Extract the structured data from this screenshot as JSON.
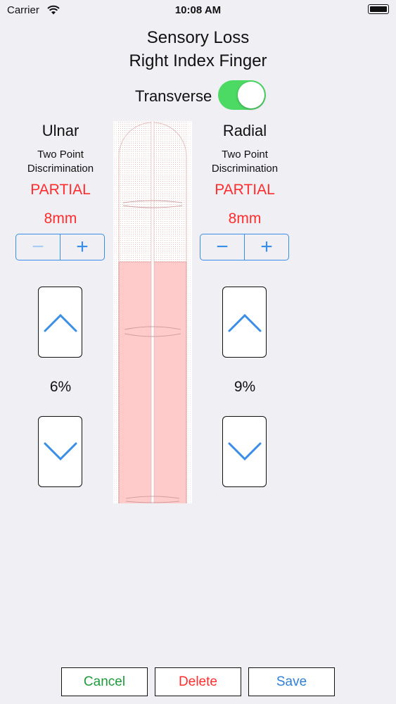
{
  "status_bar": {
    "carrier": "Carrier",
    "time": "10:08 AM"
  },
  "header": {
    "title_line1": "Sensory Loss",
    "title_line2": "Right Index Finger"
  },
  "toggle": {
    "label": "Transverse",
    "state": "on",
    "color": "#4cd964"
  },
  "ulnar": {
    "title": "Ulnar",
    "test_line1": "Two Point",
    "test_line2": "Discrimination",
    "status": "PARTIAL",
    "distance": "8mm",
    "percent": "6%"
  },
  "radial": {
    "title": "Radial",
    "test_line1": "Two Point",
    "test_line2": "Discrimination",
    "status": "PARTIAL",
    "distance": "8mm",
    "percent": "9%"
  },
  "stepper": {
    "minus": "−",
    "plus": "+"
  },
  "icons": {
    "up": "chevron-up-icon",
    "down": "chevron-down-icon",
    "wifi": "wifi-icon",
    "battery": "battery-icon"
  },
  "colors": {
    "accent": "#3a8ee6",
    "alert": "#ff2d2d",
    "toggle_on": "#4cd964",
    "loss_fill": "#ffcaca"
  },
  "footer": {
    "cancel": "Cancel",
    "delete": "Delete",
    "save": "Save"
  }
}
